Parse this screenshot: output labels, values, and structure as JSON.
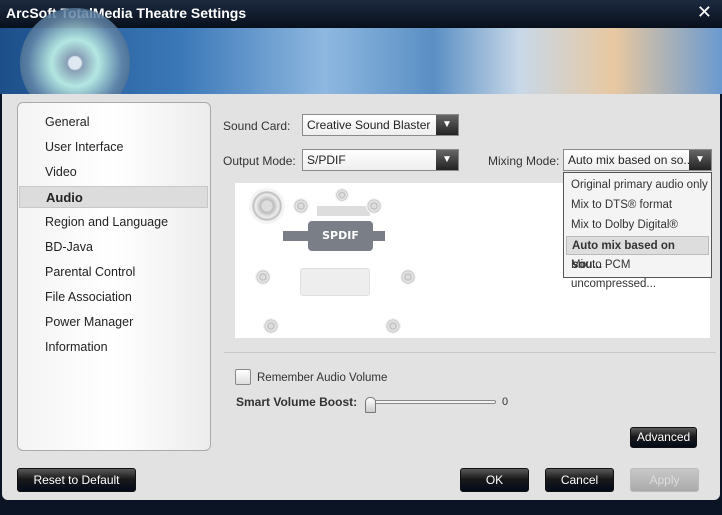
{
  "window": {
    "title": "ArcSoft TotalMedia Theatre Settings",
    "close_icon": "close-icon"
  },
  "sidebar": {
    "items": [
      {
        "label": "General"
      },
      {
        "label": "User Interface"
      },
      {
        "label": "Video"
      },
      {
        "label": "Audio",
        "selected": true
      },
      {
        "label": "Region and Language"
      },
      {
        "label": "BD-Java"
      },
      {
        "label": "Parental Control"
      },
      {
        "label": "File Association"
      },
      {
        "label": "Power Manager"
      },
      {
        "label": "Information"
      }
    ]
  },
  "audio": {
    "sound_card_label": "Sound Card:",
    "sound_card_value": "Creative Sound Blaster",
    "output_mode_label": "Output Mode:",
    "output_mode_value": "S/PDIF",
    "mixing_mode_label": "Mixing Mode:",
    "mixing_mode_value": "Auto mix based on so...",
    "mixing_options": [
      "Original primary audio only",
      "Mix to DTS® format",
      "Mix to Dolby Digital® format",
      "Auto mix based on sou...",
      "Mix to PCM uncompressed..."
    ],
    "mixing_selected_index": 3,
    "diagram_label": "SPDIF",
    "remember_volume_label": "Remember Audio Volume",
    "remember_volume_checked": false,
    "boost_label": "Smart Volume Boost:",
    "boost_value": "0",
    "advanced_label": "Advanced"
  },
  "footer": {
    "reset_label": "Reset to Default",
    "ok_label": "OK",
    "cancel_label": "Cancel",
    "apply_label": "Apply"
  }
}
